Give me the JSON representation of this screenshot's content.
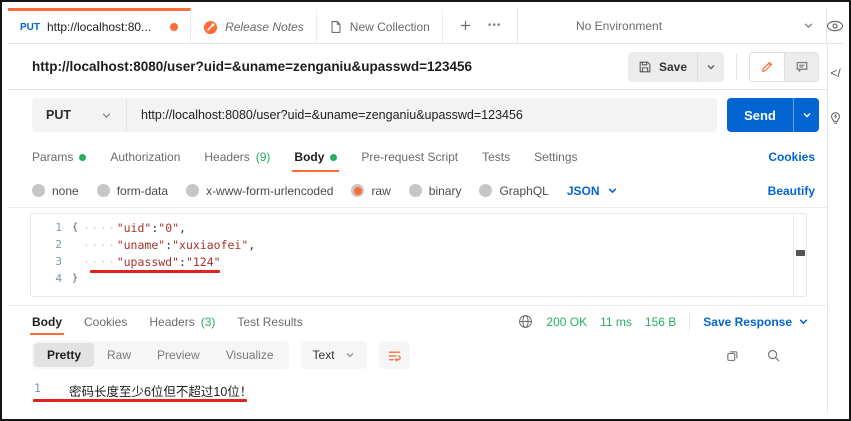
{
  "topbar": {
    "tabs": [
      {
        "method": "PUT",
        "title": "http://localhost:80..."
      },
      {
        "title": "Release Notes"
      },
      {
        "title": "New Collection"
      }
    ],
    "more_icon": "•••",
    "environment": "No Environment"
  },
  "rail": {
    "code_icon": "</"
  },
  "request": {
    "title": "http://localhost:8080/user?uid=&uname=zenganiu&upasswd=123456",
    "save_label": "Save",
    "method": "PUT",
    "url": "http://localhost:8080/user?uid=&uname=zenganiu&upasswd=123456",
    "send_label": "Send",
    "tabs": [
      {
        "label": "Params"
      },
      {
        "label": "Authorization"
      },
      {
        "label": "Headers",
        "count": "(9)"
      },
      {
        "label": "Body"
      },
      {
        "label": "Pre-request Script"
      },
      {
        "label": "Tests"
      },
      {
        "label": "Settings"
      }
    ],
    "cookies_link": "Cookies",
    "body_modes": [
      "none",
      "form-data",
      "x-www-form-urlencoded",
      "raw",
      "binary",
      "GraphQL"
    ],
    "selected_mode": "raw",
    "language": "JSON",
    "beautify_link": "Beautify",
    "editor_lines": [
      {
        "num": "1",
        "brace": "{",
        "indent": "····",
        "key": "\"uid\"",
        "colon": ":",
        "value": "\"0\"",
        "comma": ","
      },
      {
        "num": "2",
        "indent": "····",
        "key": "\"uname\"",
        "colon": ":",
        "value": "\"xuxiaofei\"",
        "comma": ","
      },
      {
        "num": "3",
        "indent": "····",
        "key": "\"upasswd\"",
        "colon": ":",
        "value": "\"124\""
      },
      {
        "num": "4",
        "brace": "}"
      }
    ]
  },
  "response": {
    "tabs": [
      {
        "label": "Body"
      },
      {
        "label": "Cookies"
      },
      {
        "label": "Headers",
        "count": "(3)"
      },
      {
        "label": "Test Results"
      }
    ],
    "status": "200 OK",
    "time": "11 ms",
    "size": "156 B",
    "save_response": "Save Response",
    "view_tabs": [
      "Pretty",
      "Raw",
      "Preview",
      "Visualize"
    ],
    "format": "Text",
    "body_line": {
      "num": "1",
      "text": "密码长度至少6位但不超过10位！"
    }
  },
  "colors": {
    "accent_orange": "#FF6C37",
    "link_blue": "#0265D2",
    "success_green": "#27AE60",
    "annotation_red": "#E0231C",
    "code_string_red": "#A5332D"
  }
}
